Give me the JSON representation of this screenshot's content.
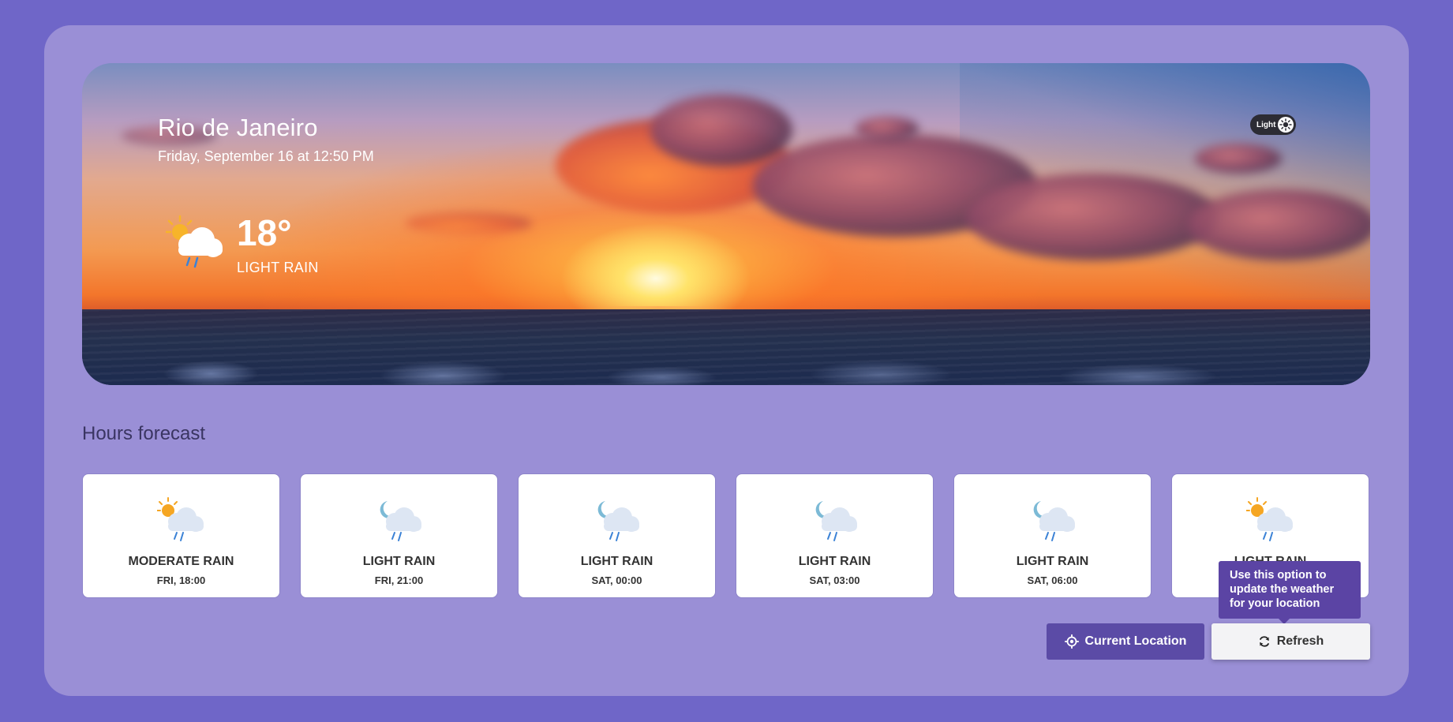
{
  "current": {
    "city": "Rio de Janeiro",
    "date": "Friday, September 16 at 12:50 PM",
    "temperature": "18°",
    "condition": "LIGHT RAIN",
    "icon": "sun-cloud-rain-icon"
  },
  "theme_toggle": {
    "label": "Light",
    "icon": "sun-icon"
  },
  "forecast": {
    "title": "Hours forecast",
    "items": [
      {
        "condition": "MODERATE RAIN",
        "time": "FRI, 18:00",
        "icon": "sun-cloud-rain-icon"
      },
      {
        "condition": "LIGHT RAIN",
        "time": "FRI, 21:00",
        "icon": "moon-cloud-rain-icon"
      },
      {
        "condition": "LIGHT RAIN",
        "time": "SAT, 00:00",
        "icon": "moon-cloud-rain-icon"
      },
      {
        "condition": "LIGHT RAIN",
        "time": "SAT, 03:00",
        "icon": "moon-cloud-rain-icon"
      },
      {
        "condition": "LIGHT RAIN",
        "time": "SAT, 06:00",
        "icon": "moon-cloud-rain-icon"
      },
      {
        "condition": "LIGHT RAIN",
        "time": "",
        "icon": "sun-cloud-rain-icon"
      }
    ]
  },
  "actions": {
    "current_location": {
      "label": "Current Location",
      "icon": "crosshair-icon"
    },
    "refresh": {
      "label": "Refresh",
      "icon": "refresh-icon"
    },
    "tooltip": "Use this option to update the weather for your location"
  },
  "colors": {
    "page_bg": "#6f66c8",
    "card_bg": "#9a8fd6",
    "primary_button": "#5b4ba6",
    "tooltip_bg": "#5b44a4"
  }
}
